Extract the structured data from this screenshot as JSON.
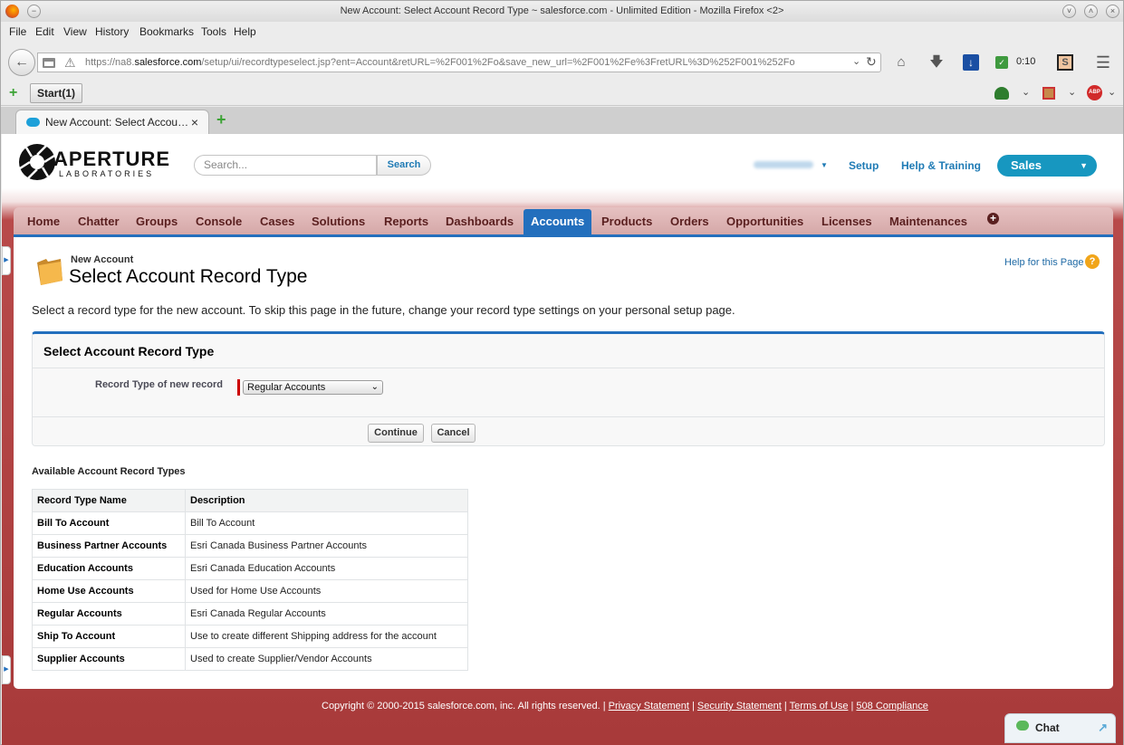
{
  "window": {
    "title": "New Account: Select Account Record Type ~ salesforce.com - Unlimited Edition - Mozilla Firefox <2>"
  },
  "menu": [
    "File",
    "Edit",
    "View",
    "History",
    "Bookmarks",
    "Tools",
    "Help"
  ],
  "nav": {
    "url_prefix": "https://na8.",
    "url_host": "salesforce.com",
    "url_rest": "/setup/ui/recordtypeselect.jsp?ent=Account&retURL=%2F001%2Fo&save_new_url=%2F001%2Fe%3FretURL%3D%252F001%252Fo",
    "timer": "0:10"
  },
  "bookmarks": {
    "start_label": "Start(1)"
  },
  "tab": {
    "label": "New Account: Select Accou…"
  },
  "header": {
    "logo_main": "APERTURE",
    "logo_sub": "LABORATORIES",
    "search_placeholder": "Search...",
    "search_button": "Search",
    "setup": "Setup",
    "help_training": "Help & Training",
    "app": "Sales"
  },
  "sf_tabs": [
    "Home",
    "Chatter",
    "Groups",
    "Console",
    "Cases",
    "Solutions",
    "Reports",
    "Dashboards",
    "Accounts",
    "Products",
    "Orders",
    "Opportunities",
    "Licenses",
    "Maintenances"
  ],
  "page": {
    "crumb": "New Account",
    "title": "Select Account Record Type",
    "help": "Help for this Page",
    "instructions": "Select a record type for the new account. To skip this page in the future, change your record type settings on your personal setup page.",
    "section_title": "Select Account Record Type",
    "field_label": "Record Type of new record",
    "selected_value": "Regular Accounts",
    "continue": "Continue",
    "cancel": "Cancel",
    "available_title": "Available Account Record Types"
  },
  "table": {
    "headers": [
      "Record Type Name",
      "Description"
    ],
    "rows": [
      [
        "Bill To Account",
        "Bill To Account"
      ],
      [
        "Business Partner Accounts",
        "Esri Canada Business Partner Accounts"
      ],
      [
        "Education Accounts",
        "Esri Canada Education Accounts"
      ],
      [
        "Home Use Accounts",
        "Used for Home Use Accounts"
      ],
      [
        "Regular Accounts",
        "Esri Canada Regular Accounts"
      ],
      [
        "Ship To Account",
        "Use to create different Shipping address for the account"
      ],
      [
        "Supplier Accounts",
        "Used to create Supplier/Vendor Accounts"
      ]
    ]
  },
  "footer": {
    "copyright": "Copyright © 2000-2015 salesforce.com, inc. All rights reserved. |",
    "links": [
      "Privacy Statement",
      "Security Statement",
      "Terms of Use",
      "508 Compliance"
    ]
  },
  "chat": {
    "label": "Chat"
  },
  "colors": {
    "brand_blue": "#236fbd",
    "app_button": "#1797c0",
    "header_red": "#a83a3a"
  }
}
